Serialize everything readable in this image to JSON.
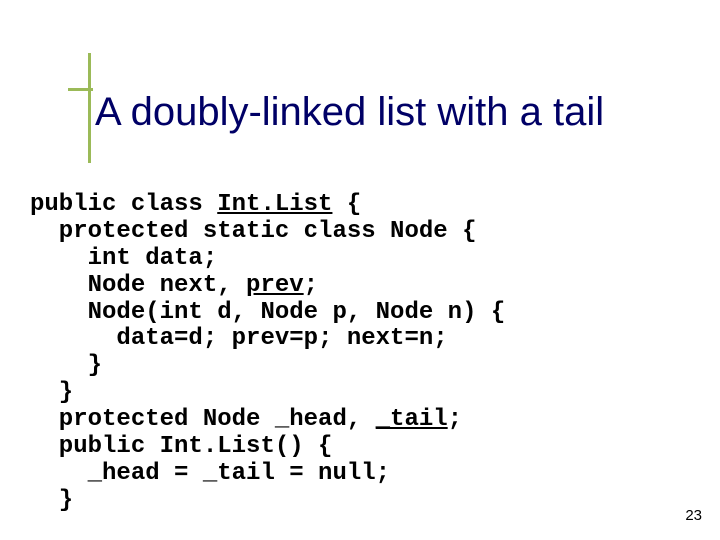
{
  "title": "A doubly-linked list with a tail",
  "code": {
    "l1a": "public class ",
    "l1b": "Int.List",
    "l1c": " {",
    "l2": "  protected static class Node {",
    "l3": "    int data;",
    "l4a": "    Node next, ",
    "l4b": "prev",
    "l4c": ";",
    "l5": "    Node(int d, Node p, Node n) {",
    "l6": "      data=d; prev=p; next=n;",
    "l7": "    }",
    "l8": "  }",
    "l9a": "  protected Node _head, ",
    "l9b": "_tail",
    "l9c": ";",
    "l10": "  public Int.List() {",
    "l11": "    _head = _tail = null;",
    "l12": "  }"
  },
  "page_number": "23"
}
